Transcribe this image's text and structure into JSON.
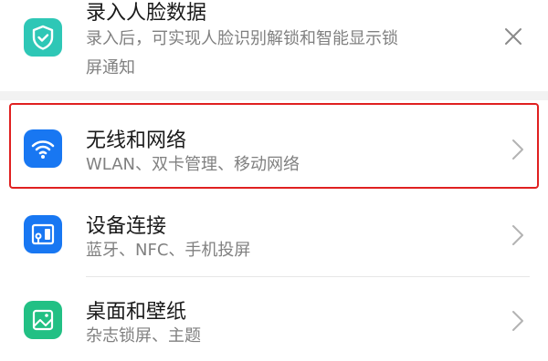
{
  "face_prompt": {
    "title": "录入人脸数据",
    "subtitle_line1": "录入后，可实现人脸识别解锁和智能显示锁",
    "subtitle_line2": "屏通知"
  },
  "settings": [
    {
      "title": "无线和网络",
      "subtitle": "WLAN、双卡管理、移动网络",
      "icon": "wifi-icon"
    },
    {
      "title": "设备连接",
      "subtitle": "蓝牙、NFC、手机投屏",
      "icon": "device-connection-icon"
    },
    {
      "title": "桌面和壁纸",
      "subtitle": "杂志锁屏、主题",
      "icon": "wallpaper-icon"
    }
  ],
  "colors": {
    "teal": "#2ec7b6",
    "blue": "#1877f2",
    "green": "#22c084",
    "highlight": "#e02020",
    "section_gap": "#f2f2f2"
  }
}
